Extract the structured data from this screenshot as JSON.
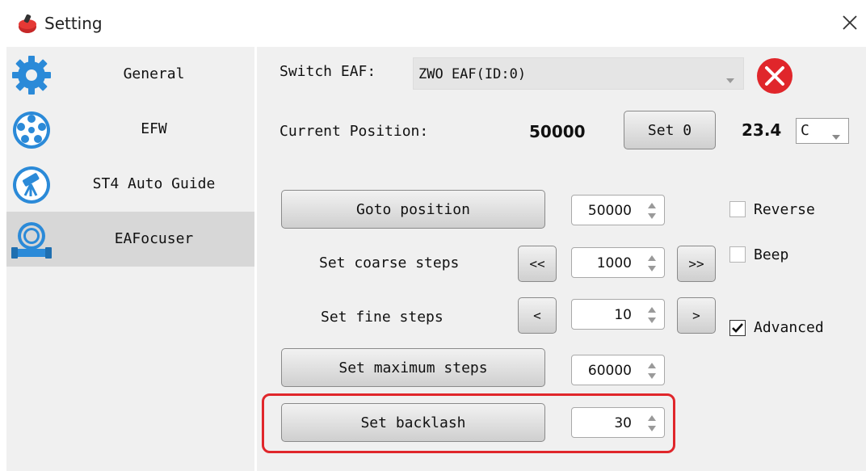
{
  "window": {
    "title": "Setting"
  },
  "sidebar": {
    "items": [
      {
        "label": "General",
        "icon": "gear-icon"
      },
      {
        "label": "EFW",
        "icon": "filter-wheel-icon"
      },
      {
        "label": "ST4 Auto Guide",
        "icon": "telescope-icon"
      },
      {
        "label": "EAFocuser",
        "icon": "focuser-icon",
        "active": true
      }
    ]
  },
  "main": {
    "switch_label": "Switch EAF:",
    "switch_value": "ZWO EAF(ID:0)",
    "current_position_label": "Current Position:",
    "current_position_value": "50000",
    "set_zero_label": "Set 0",
    "temperature_value": "23.4",
    "temperature_unit": "C",
    "goto_label": "Goto position",
    "goto_value": "50000",
    "coarse_label": "Set coarse steps",
    "coarse_dec": "<<",
    "coarse_value": "1000",
    "coarse_inc": ">>",
    "fine_label": "Set fine steps",
    "fine_dec": "<",
    "fine_value": "10",
    "fine_inc": ">",
    "max_label": "Set maximum steps",
    "max_value": "60000",
    "backlash_label": "Set backlash",
    "backlash_value": "30",
    "reverse_label": "Reverse",
    "reverse_checked": false,
    "beep_label": "Beep",
    "beep_checked": false,
    "advanced_label": "Advanced",
    "advanced_checked": true
  },
  "colors": {
    "accent_blue": "#2b8ad8",
    "disconnect_red": "#e0262b",
    "highlight_red": "#e0262b"
  }
}
